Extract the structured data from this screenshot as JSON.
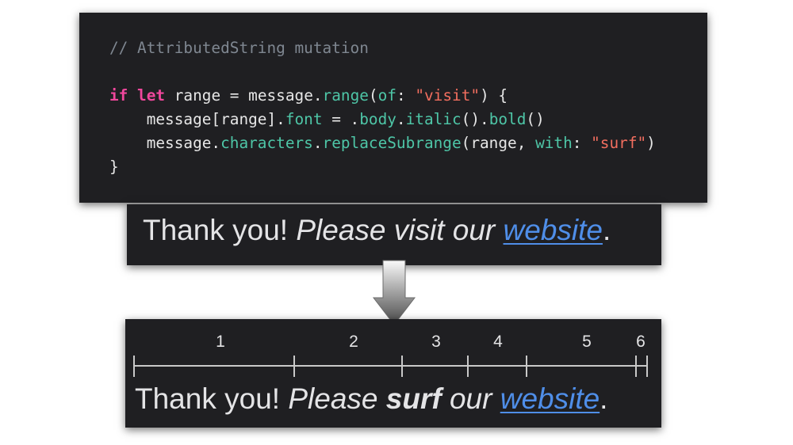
{
  "code": {
    "comment": "// AttributedString mutation",
    "kw_if": "if",
    "kw_let": "let",
    "t1": " range = message.",
    "fn_range": "range",
    "p1": "(",
    "fn_of": "of",
    "p2": ": ",
    "str_visit": "\"visit\"",
    "p3": ") {",
    "l2a": "    message[range].",
    "fn_font": "font",
    "l2b": " = .",
    "fn_body": "body",
    "l2c": ".",
    "fn_italic": "italic",
    "l2d": "().",
    "fn_bold": "bold",
    "l2e": "()",
    "l3a": "    message.",
    "fn_characters": "characters",
    "l3b": ".",
    "fn_replace": "replaceSubrange",
    "l3c": "(range, ",
    "fn_with": "with",
    "l3d": ": ",
    "str_surf": "\"surf\"",
    "l3e": ")",
    "close": "}"
  },
  "before": {
    "plain": "Thank you! ",
    "italic1": "Please visit our ",
    "link": "website",
    "period": "."
  },
  "after": {
    "plain": "Thank you! ",
    "italic1": "Please ",
    "bold_italic": "surf",
    "italic2": " our ",
    "link": "website",
    "period": "."
  },
  "runs": [
    "1",
    "2",
    "3",
    "4",
    "5",
    "6"
  ],
  "colors": {
    "panel_bg": "#1f1f22",
    "link": "#4f8ee8",
    "keyword": "#f0479c",
    "function": "#4ec6a7",
    "string": "#f26e5f",
    "comment": "#7f8791"
  }
}
